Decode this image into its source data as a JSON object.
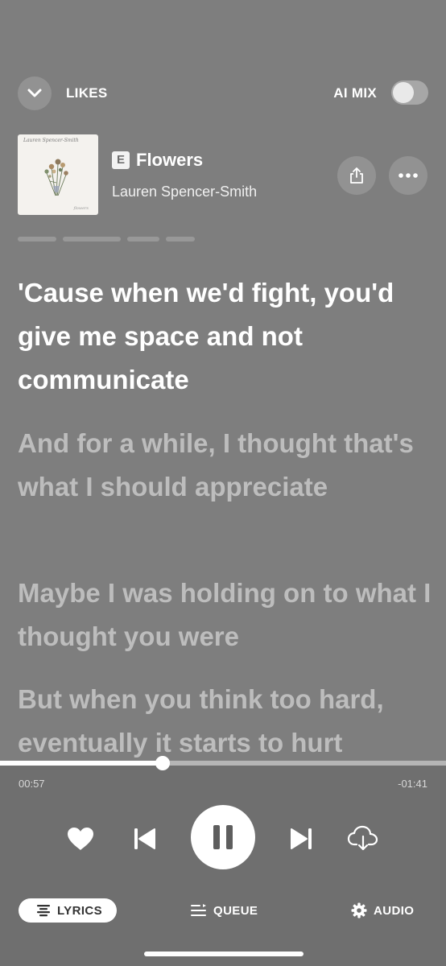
{
  "header": {
    "playlist_title": "LIKES",
    "ai_mix_label": "AI MIX",
    "ai_mix_enabled": false
  },
  "track": {
    "explicit_badge": "E",
    "title": "Flowers",
    "artist": "Lauren Spencer-Smith",
    "album_art_script": "Lauren Spencer-Smith",
    "album_art_footer": "flowers"
  },
  "lyrics": [
    {
      "text": "'Cause when we'd fight, you'd give me space and not communicate",
      "state": "active"
    },
    {
      "text": "And for a while, I thought that's what I should appreciate",
      "state": "inactive"
    },
    {
      "text": "Maybe I was holding on to what I thought you were",
      "state": "inactive"
    },
    {
      "text": "But when you think too hard, eventually it starts to hurt",
      "state": "inactive"
    }
  ],
  "playback": {
    "elapsed": "00:57",
    "remaining": "-01:41",
    "progress_fraction": 0.365
  },
  "icons": {
    "collapse": "chevron-down-icon",
    "share": "share-icon",
    "more": "more-icon",
    "like": "heart-icon",
    "previous": "skip-previous-icon",
    "pause": "pause-icon",
    "next": "skip-next-icon",
    "download": "cloud-download-icon"
  },
  "tabs": [
    {
      "label": "LYRICS",
      "icon": "lyrics-icon",
      "selected": true
    },
    {
      "label": "QUEUE",
      "icon": "queue-icon",
      "selected": false
    },
    {
      "label": "AUDIO",
      "icon": "gear-icon",
      "selected": false
    }
  ],
  "colors": {
    "background": "#7e7e7e",
    "controls_background": "#6f6f6f",
    "active_lyric": "#ffffff",
    "inactive_lyric": "#bdbdbd"
  }
}
